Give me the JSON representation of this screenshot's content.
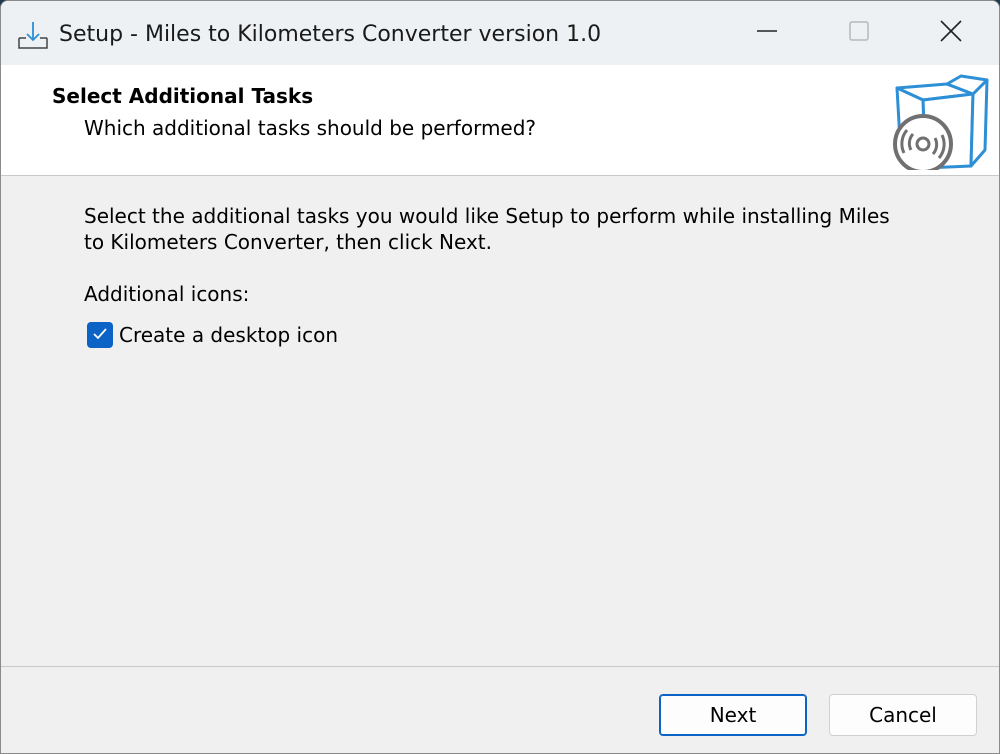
{
  "window": {
    "title": "Setup - Miles to Kilometers Converter version 1.0",
    "icon": "download-setup-icon",
    "controls": [
      "minimize-icon",
      "maximize-icon",
      "close-icon"
    ]
  },
  "header": {
    "title": "Select Additional Tasks",
    "subtitle": "Which additional tasks should be performed?",
    "image": "software-box-icon"
  },
  "body": {
    "description": "Select the additional tasks you would like Setup to perform while installing Miles to Kilometers Converter, then click Next.",
    "group_label": "Additional icons:",
    "tasks": [
      {
        "label": "Create a desktop icon",
        "checked": true
      }
    ]
  },
  "footer": {
    "next_label": "Next",
    "cancel_label": "Cancel"
  },
  "colors": {
    "accent": "#0a63c5",
    "box_blue": "#2d8fd5",
    "window_bg": "#f0f0f0"
  }
}
